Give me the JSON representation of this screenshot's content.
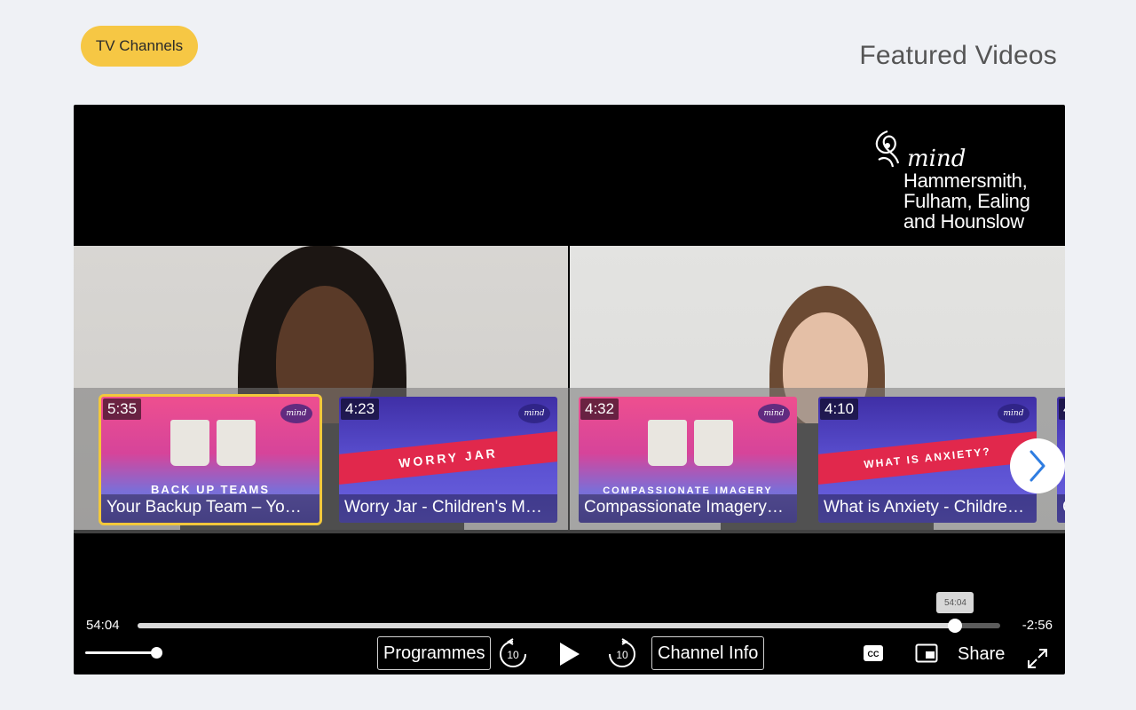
{
  "header": {
    "channels_button": "TV Channels",
    "page_title": "Featured Videos"
  },
  "player": {
    "logo": {
      "brand": "mind",
      "lines": [
        "Hammersmith,",
        "Fulham, Ealing",
        "and Hounslow"
      ]
    },
    "carousel": {
      "videos": [
        {
          "duration": "5:35",
          "title": "Your Backup Team – Yo…",
          "thumb_caption": "BACK UP TEAMS",
          "selected": true
        },
        {
          "duration": "4:23",
          "title": "Worry Jar - Children's M…",
          "thumb_caption": "WORRY JAR",
          "selected": false
        },
        {
          "duration": "4:32",
          "title": "Compassionate Imagery…",
          "thumb_caption": "COMPASSIONATE IMAGERY",
          "selected": false
        },
        {
          "duration": "4:10",
          "title": "What is Anxiety - Childre…",
          "thumb_caption": "WHAT IS ANXIETY?",
          "selected": false
        }
      ],
      "partial_duration": "4",
      "partial_title": "C"
    },
    "progress": {
      "current": "54:04",
      "remaining": "-2:56",
      "tooltip": "54:04",
      "fraction": 0.948
    },
    "volume": {
      "level": 1.0
    },
    "controls": {
      "programmes": "Programmes",
      "rewind_seconds": "10",
      "forward_seconds": "10",
      "channel_info": "Channel Info",
      "cc": "CC",
      "share": "Share"
    },
    "colors": {
      "accent_yellow": "#f6c744",
      "selected_outline": "#f2c83b"
    }
  }
}
